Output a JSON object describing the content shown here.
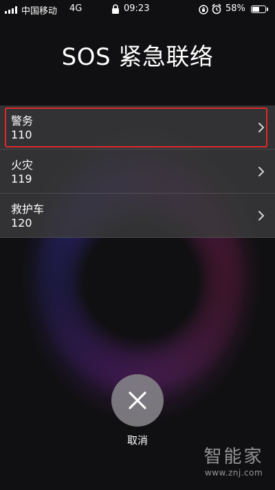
{
  "status_bar": {
    "carrier": "中国移动",
    "network": "4G",
    "time": "09:23",
    "battery_percent": "58%",
    "battery_level": 0.58,
    "icons": [
      "signal-icon",
      "lock-icon",
      "rotation-lock-icon",
      "alarm-icon",
      "battery-icon"
    ]
  },
  "title": "SOS 紧急联络",
  "contacts": [
    {
      "name": "警务",
      "number": "110",
      "highlighted": true
    },
    {
      "name": "火灾",
      "number": "119",
      "highlighted": false
    },
    {
      "name": "救护车",
      "number": "120",
      "highlighted": false
    }
  ],
  "cancel": {
    "icon": "close-icon",
    "label": "取消"
  },
  "watermark": {
    "brand": "智能家",
    "url": "www.znj.com"
  },
  "colors": {
    "highlight_frame": "#e02b2b",
    "row_background": "#3a3a3c",
    "cancel_button": "#828086",
    "background": "#101012"
  }
}
